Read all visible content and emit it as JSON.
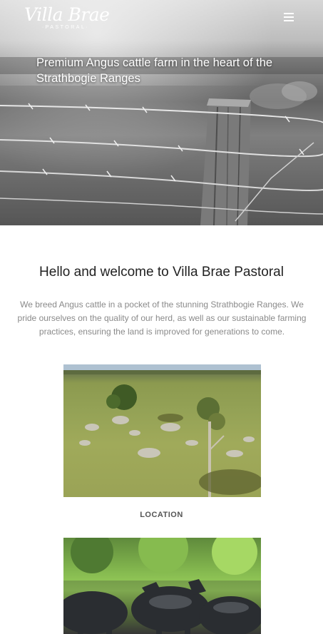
{
  "header": {
    "logo_title": "Villa Brae",
    "logo_subtitle": "·PASTORAL·"
  },
  "hero": {
    "tagline": "Premium Angus cattle farm in the heart of the Strathbogie Ranges"
  },
  "welcome": {
    "title": "Hello and welcome to Villa Brae Pastoral",
    "text": "We breed Angus cattle in a pocket of the stunning Strathbogie Ranges. We pride ourselves on the quality of our herd, as well as our sustainable farming practices, ensuring the land is improved for generations to come."
  },
  "cards": [
    {
      "label": "LOCATION",
      "image": "farm-landscape-photo"
    },
    {
      "label": "",
      "image": "angus-cattle-photo"
    }
  ],
  "icons": {
    "menu": "hamburger-menu-icon"
  },
  "colors": {
    "hero_overlay_text": "#ffffff",
    "title": "#222222",
    "body_text": "#8a8a8a"
  }
}
